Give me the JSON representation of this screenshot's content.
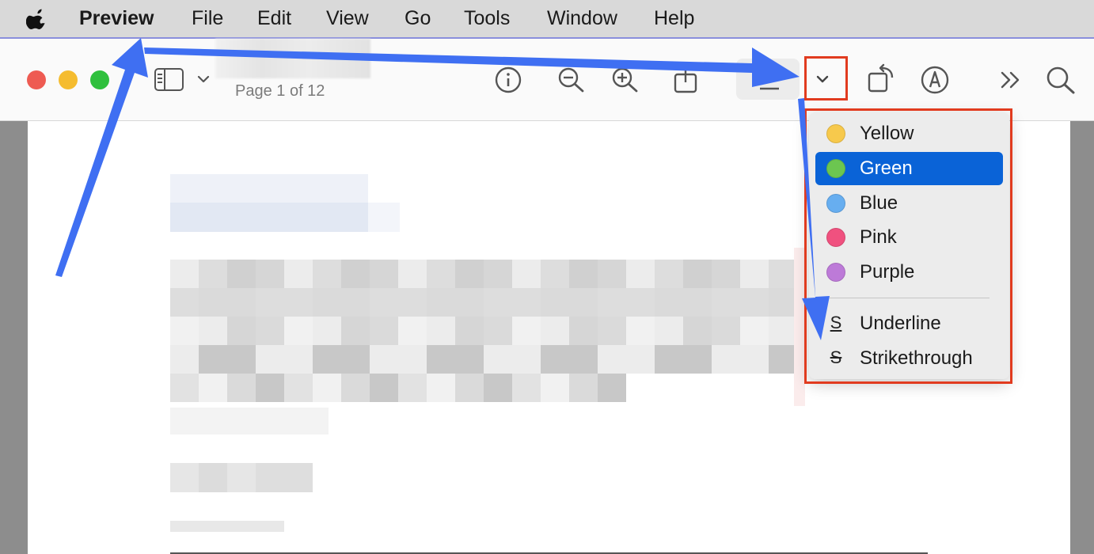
{
  "menubar": {
    "app_name": "Preview",
    "items": [
      "File",
      "Edit",
      "View",
      "Go",
      "Tools",
      "Window",
      "Help"
    ]
  },
  "toolbar": {
    "page_indicator": "Page 1 of 12"
  },
  "highlight_menu": {
    "colors": [
      {
        "label": "Yellow",
        "color": "#f7c94c",
        "selected": false
      },
      {
        "label": "Green",
        "color": "#6cc650",
        "selected": true
      },
      {
        "label": "Blue",
        "color": "#67aef0",
        "selected": false
      },
      {
        "label": "Pink",
        "color": "#f0517f",
        "selected": false
      },
      {
        "label": "Purple",
        "color": "#bd7ad8",
        "selected": false
      }
    ],
    "styles": [
      {
        "label": "Underline",
        "icon": "underline-icon"
      },
      {
        "label": "Strikethrough",
        "icon": "strikethrough-icon"
      }
    ]
  },
  "colors": {
    "annotation_arrow": "#3f6ff2",
    "annotation_box": "#e13b1f",
    "selection": "#0a63d7"
  }
}
